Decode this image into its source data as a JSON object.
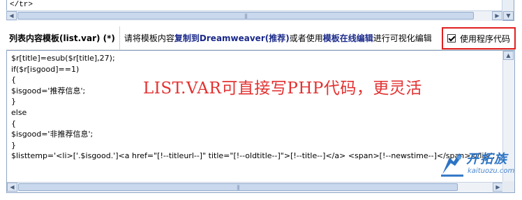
{
  "top_editor": {
    "code_line": "</tr>",
    "code_line2": "  <!-- ... -->"
  },
  "toolbar": {
    "title": "列表内容模板(list.var) (*)",
    "desc_1": "请将模板内容",
    "desc_bold_1": "复制到Dreamweaver(推荐)",
    "desc_2": "或者使用",
    "desc_bold_2": "模板在线编辑",
    "desc_3": "进行可视化编辑",
    "use_program_code_label": "使用程序代码",
    "use_program_code_checked": true
  },
  "editor": {
    "code": "$r[title]=esub($r[title],27);\nif($r[isgood]==1)\n{\n$isgood='推荐信息';\n}\nelse\n{\n$isgood='非推荐信息';\n}\n$listtemp='<li>['.$isgood.']<a href=\"[!--titleurl--]\" title=\"[!--oldtitle--]\">[!--title--]</a> <span>[!--newstime--]</span></li>';",
    "overlay_text": "LIST.VAR可直接写PHP代码，更灵活"
  },
  "watermark": {
    "brand_cn": "开拓族",
    "brand_en": "kaituozu.com",
    "color": "#2e74c4"
  },
  "colors": {
    "highlight_border": "#e02020",
    "overlay_text": "#e33131",
    "editor_border": "#8fa6c7"
  }
}
